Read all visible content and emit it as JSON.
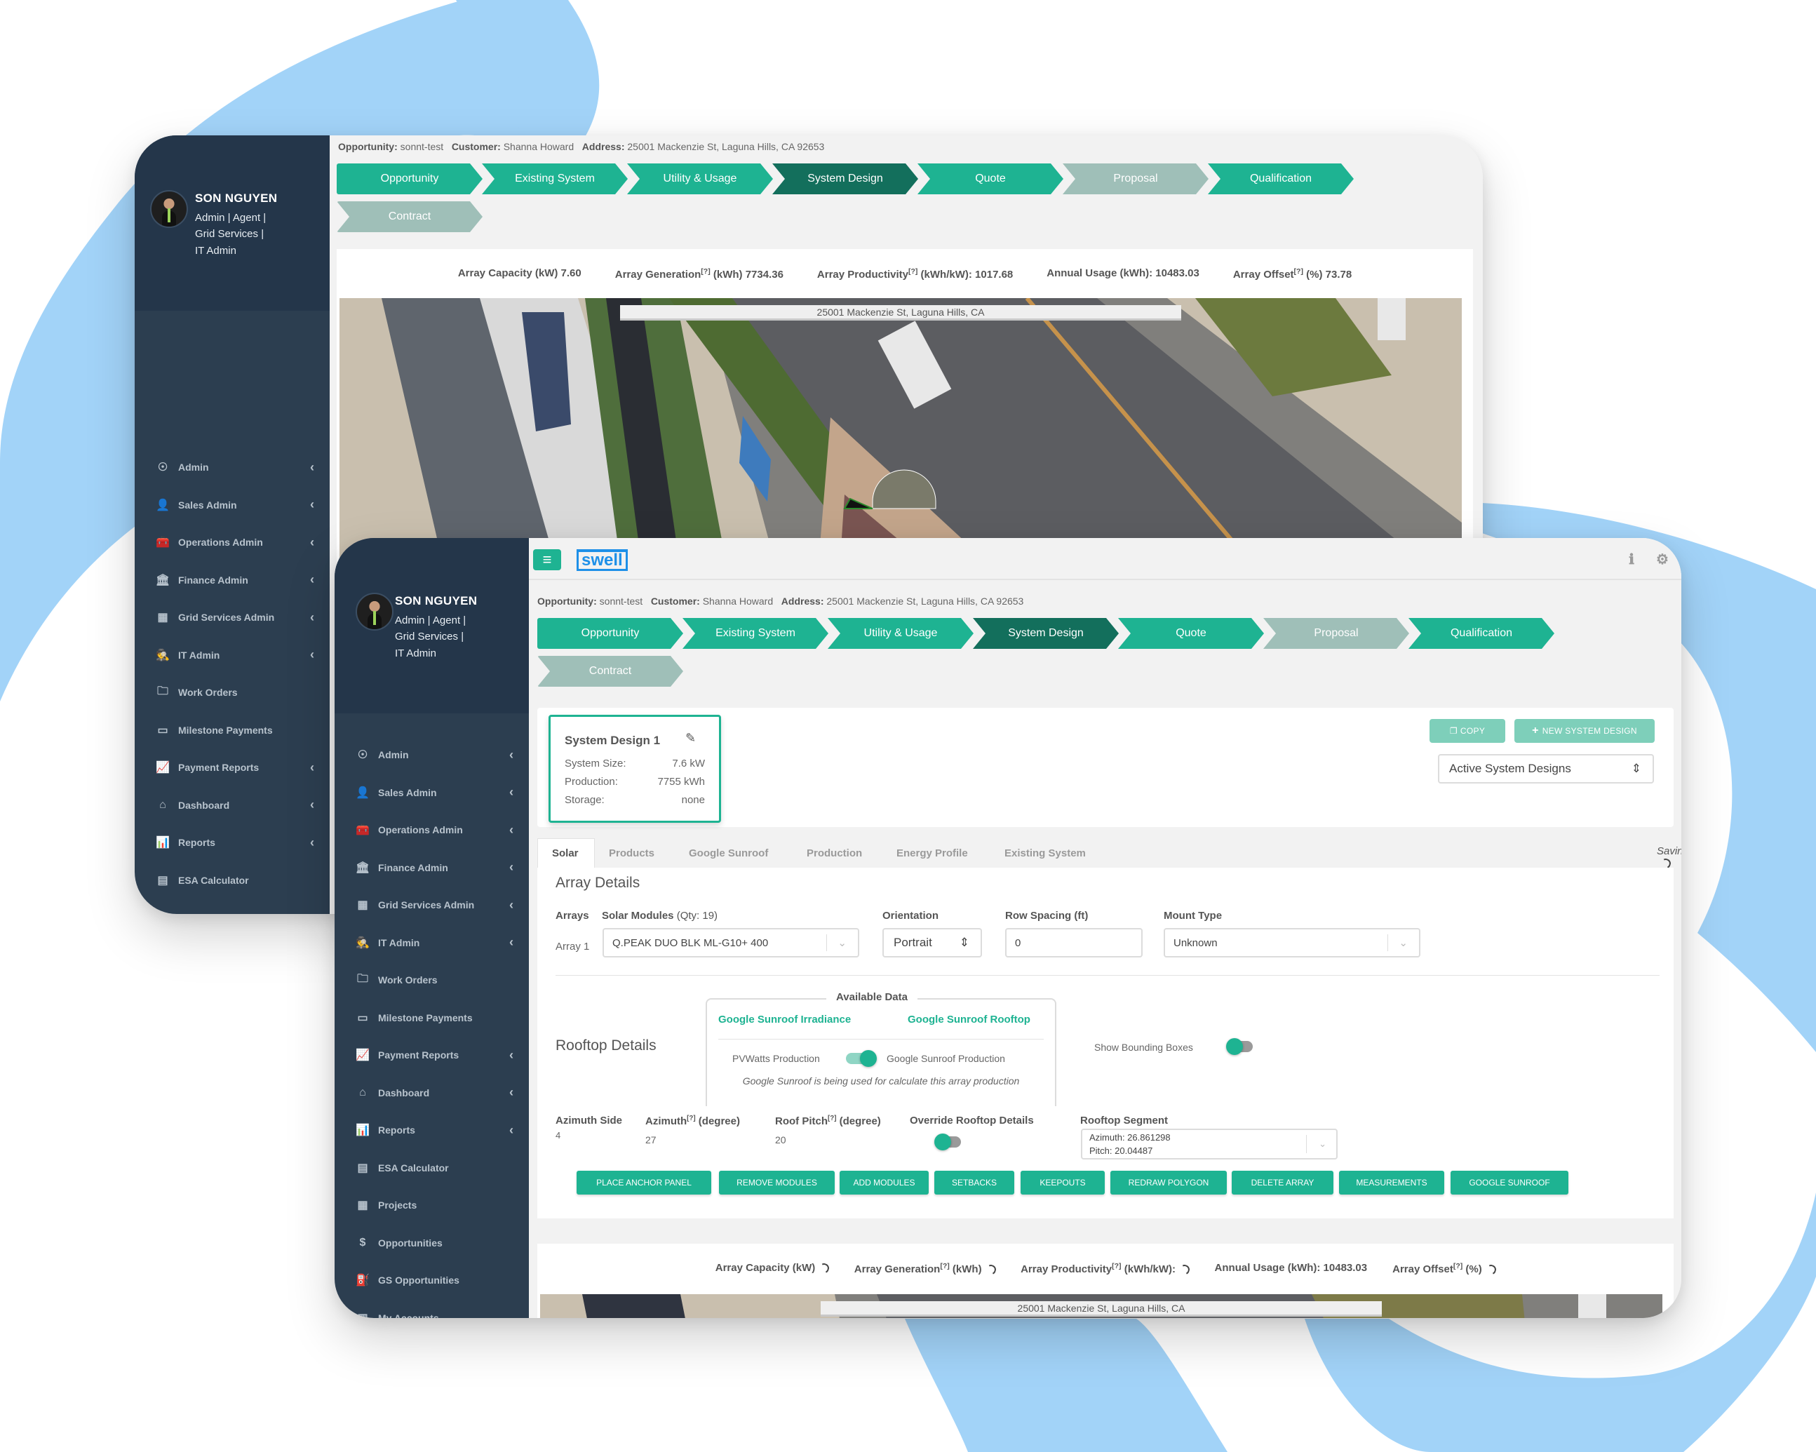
{
  "user": {
    "name": "SON NGUYEN",
    "roles": [
      "Admin | Agent |",
      "Grid Services |",
      "IT Admin"
    ]
  },
  "sidebar": {
    "items": [
      {
        "label": "Admin",
        "icon": "universal-access-icon",
        "glyph": "☉",
        "expandable": true
      },
      {
        "label": "Sales Admin",
        "icon": "user-tie-icon",
        "glyph": "👤",
        "expandable": true
      },
      {
        "label": "Operations Admin",
        "icon": "toolbox-icon",
        "glyph": "🧰",
        "expandable": true
      },
      {
        "label": "Finance Admin",
        "icon": "bank-icon",
        "glyph": "🏛",
        "expandable": true
      },
      {
        "label": "Grid Services Admin",
        "icon": "building-icon",
        "glyph": "▦",
        "expandable": true
      },
      {
        "label": "IT Admin",
        "icon": "user-secret-icon",
        "glyph": "🕵",
        "expandable": true
      },
      {
        "label": "Work Orders",
        "icon": "folder-icon",
        "glyph": "🗀",
        "expandable": false
      },
      {
        "label": "Milestone Payments",
        "icon": "credit-card-icon",
        "glyph": "▭",
        "expandable": false
      },
      {
        "label": "Payment Reports",
        "icon": "chart-line-icon",
        "glyph": "📈",
        "expandable": true
      },
      {
        "label": "Dashboard",
        "icon": "home-icon",
        "glyph": "⌂",
        "expandable": true
      },
      {
        "label": "Reports",
        "icon": "chart-bar-icon",
        "glyph": "📊",
        "expandable": true
      },
      {
        "label": "ESA Calculator",
        "icon": "calculator-icon",
        "glyph": "▤",
        "expandable": false
      },
      {
        "label": "Projects",
        "icon": "grid-icon",
        "glyph": "▦",
        "expandable": false
      },
      {
        "label": "Opportunities",
        "icon": "dollar-icon",
        "glyph": "$",
        "expandable": false
      },
      {
        "label": "GS Opportunities",
        "icon": "charging-station-icon",
        "glyph": "⛽",
        "expandable": false
      },
      {
        "label": "My Accounts",
        "icon": "building-outline-icon",
        "glyph": "▥",
        "expandable": false
      }
    ],
    "chevron": "‹"
  },
  "crumbs": {
    "opportunity_label": "Opportunity:",
    "opportunity": "sonnt-test",
    "customer_label": "Customer:",
    "customer": "Shanna Howard",
    "address_label": "Address:",
    "address": "25001 Mackenzie St, Laguna Hills, CA 92653"
  },
  "steps": [
    {
      "label": "Opportunity",
      "state": "done"
    },
    {
      "label": "Existing System",
      "state": "done"
    },
    {
      "label": "Utility & Usage",
      "state": "done"
    },
    {
      "label": "System Design",
      "state": "active"
    },
    {
      "label": "Quote",
      "state": "done"
    },
    {
      "label": "Proposal",
      "state": "disabled"
    },
    {
      "label": "Qualification",
      "state": "done"
    },
    {
      "label": "Contract",
      "state": "disabled"
    }
  ],
  "back_stats": {
    "capacity": "Array Capacity (kW) 7.60",
    "generation_pre": "Array Generation",
    "generation_post": " (kWh) 7734.36",
    "productivity_pre": "Array Productivity",
    "productivity_post": " (kWh/kW): 1017.68",
    "usage": "Annual Usage (kWh): 10483.03",
    "offset_pre": "Array Offset",
    "offset_post": " (%) 73.78",
    "help_mark": "[?]"
  },
  "map": {
    "address": "25001 Mackenzie St, Laguna Hills, CA"
  },
  "topbar": {
    "menu_glyph": "≡",
    "logo": "swell",
    "info_glyph": "ℹ",
    "gear_glyph": "⚙",
    "logout_glyph": "⇥"
  },
  "design_card": {
    "title": "System Design 1",
    "edit_glyph": "✎",
    "rows": [
      {
        "label": "System Size:",
        "value": "7.6 kW"
      },
      {
        "label": "Production:",
        "value": "7755 kWh"
      },
      {
        "label": "Storage:",
        "value": "none"
      }
    ]
  },
  "actions": {
    "copy": "COPY",
    "copy_glyph": "❐",
    "new_design": "NEW SYSTEM DESIGN",
    "new_glyph": "+",
    "filter_value": "Active System Designs",
    "filter_arrows": "⇕"
  },
  "tabs": [
    {
      "label": "Solar",
      "active": true
    },
    {
      "label": "Products",
      "active": false
    },
    {
      "label": "Google Sunroof",
      "active": false
    },
    {
      "label": "Production",
      "active": false
    },
    {
      "label": "Energy Profile",
      "active": false
    },
    {
      "label": "Existing System",
      "active": false
    }
  ],
  "saving": "Saving",
  "array_details": {
    "title": "Array Details",
    "arrays_label": "Arrays",
    "modules_label": "Solar Modules",
    "modules_qty": " (Qty: 19)",
    "orientation_label": "Orientation",
    "row_spacing_label": "Row Spacing (ft)",
    "mount_label": "Mount Type",
    "array_name": "Array 1",
    "module_value": "Q.PEAK DUO BLK ML-G10+ 400",
    "orientation_value": "Portrait",
    "row_spacing_value": "0",
    "mount_value": "Unknown"
  },
  "rooftop": {
    "title": "Rooftop Details",
    "available_data": "Available Data",
    "irradiance_link": "Google Sunroof Irradiance",
    "rooftop_link": "Google Sunroof Rooftop",
    "pvwatts": "PVWatts Production",
    "sunroof_production": "Google Sunroof Production",
    "note": "Google Sunroof is being used for calculate this array production",
    "bounding_boxes": "Show Bounding Boxes",
    "production_toggle_on": true,
    "bounding_boxes_on": false,
    "azimuth_side_label": "Azimuth Side",
    "azimuth_side": "4",
    "azimuth_label": "Azimuth",
    "azimuth_unit": " (degree)",
    "azimuth": "27",
    "pitch_label": "Roof Pitch",
    "pitch_unit": " (degree)",
    "pitch": "20",
    "override_label": "Override Rooftop Details",
    "override_on": false,
    "segment_label": "Rooftop Segment",
    "segment_azimuth": "Azimuth: 26.861298",
    "segment_pitch": "Pitch: 20.04487",
    "help_mark": "[?]"
  },
  "tools": [
    "PLACE ANCHOR PANEL",
    "REMOVE MODULES",
    "ADD MODULES",
    "SETBACKS",
    "KEEPOUTS",
    "REDRAW POLYGON",
    "DELETE ARRAY",
    "MEASUREMENTS",
    "GOOGLE SUNROOF"
  ],
  "front_stats": {
    "capacity": "Array Capacity (kW)",
    "generation_pre": "Array Generation",
    "generation_post": " (kWh)",
    "productivity_pre": "Array Productivity",
    "productivity_post": " (kWh/kW):",
    "usage": "Annual Usage (kWh): 10483.03",
    "offset_pre": "Array Offset",
    "offset_post": " (%)",
    "help_mark": "[?]"
  },
  "colors": {
    "brand_green": "#1eb392",
    "active_step": "#136f5c",
    "disabled_step": "#9fbfb8",
    "sidebar": "#2c3e50",
    "logo_blue": "#1e90e8",
    "background_swirl": "#a2d3f8"
  }
}
